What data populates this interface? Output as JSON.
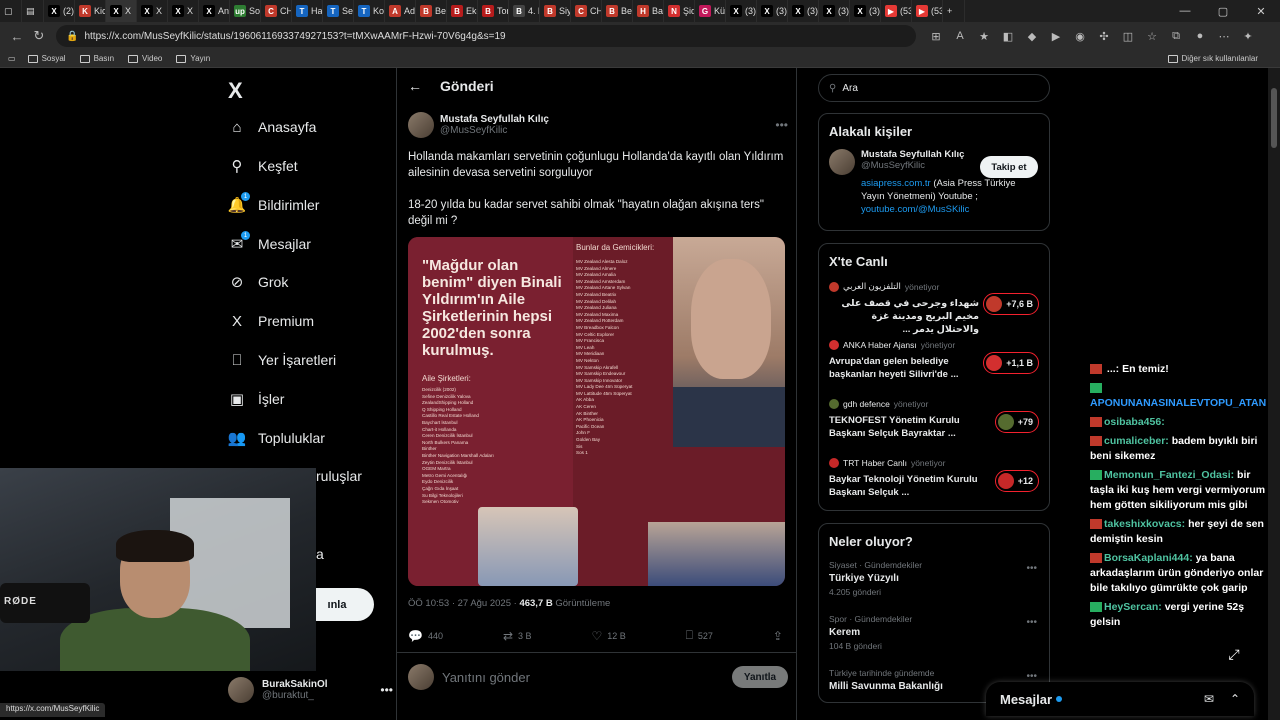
{
  "browser": {
    "tabs": [
      {
        "label": "(2) I",
        "color": "#000000",
        "glyph": "X"
      },
      {
        "label": "Kick",
        "color": "#c0392b",
        "glyph": "K"
      },
      {
        "label": "X",
        "color": "#000000",
        "glyph": "X",
        "active": true
      },
      {
        "label": "X",
        "color": "#000000",
        "glyph": "X"
      },
      {
        "label": "X",
        "color": "#000000",
        "glyph": "X"
      },
      {
        "label": "Ana",
        "color": "#000000",
        "glyph": "X"
      },
      {
        "label": "Son",
        "color": "#2e7d32",
        "glyph": "up"
      },
      {
        "label": "CHF",
        "color": "#c0392b",
        "glyph": "C"
      },
      {
        "label": "Hali",
        "color": "#1565c0",
        "glyph": "T"
      },
      {
        "label": "Selv",
        "color": "#1565c0",
        "glyph": "T"
      },
      {
        "label": "Kon",
        "color": "#1565c0",
        "glyph": "T"
      },
      {
        "label": "Ada",
        "color": "#c0392b",
        "glyph": "A"
      },
      {
        "label": "Bey",
        "color": "#c0392b",
        "glyph": "B"
      },
      {
        "label": "Eko",
        "color": "#b71c1c",
        "glyph": "B"
      },
      {
        "label": "Ton",
        "color": "#b71c1c",
        "glyph": "B"
      },
      {
        "label": "4. li",
        "color": "#444444",
        "glyph": "B"
      },
      {
        "label": "Siya",
        "color": "#c0392b",
        "glyph": "B"
      },
      {
        "label": "CHF",
        "color": "#c0392b",
        "glyph": "C"
      },
      {
        "label": "Bey",
        "color": "#c0392b",
        "glyph": "B"
      },
      {
        "label": "Bak",
        "color": "#c0392b",
        "glyph": "H"
      },
      {
        "label": "Şidd",
        "color": "#d32f2f",
        "glyph": "N"
      },
      {
        "label": "Kür",
        "color": "#c2185b",
        "glyph": "G"
      },
      {
        "label": "(3) ",
        "color": "#000000",
        "glyph": "X"
      },
      {
        "label": "(3) ",
        "color": "#000000",
        "glyph": "X"
      },
      {
        "label": "(3) ",
        "color": "#000000",
        "glyph": "X"
      },
      {
        "label": "(3) ",
        "color": "#000000",
        "glyph": "X"
      },
      {
        "label": "(3) ",
        "color": "#000000",
        "glyph": "X"
      },
      {
        "label": "(53",
        "color": "#e53935",
        "glyph": "▶"
      },
      {
        "label": "(53",
        "color": "#e53935",
        "glyph": "▶"
      }
    ],
    "url": "https://x.com/MusSeyfKilic/status/1960611693374927153?t=tMXwAAMrF-Hzwi-70V6g4g&s=19",
    "bookmarks": [
      "Sosyal",
      "Basın",
      "Video",
      "Yayın"
    ],
    "bookmarks_other": "Diğer sık kullanılanlar",
    "status_url": "https://x.com/MusSeyfKilic"
  },
  "nav": {
    "items": [
      {
        "label": "Anasayfa",
        "icon": "home-icon",
        "glyph": "⌂"
      },
      {
        "label": "Keşfet",
        "icon": "search-icon",
        "glyph": "⚲"
      },
      {
        "label": "Bildirimler",
        "icon": "bell-icon",
        "glyph": "🔔",
        "badge": "1"
      },
      {
        "label": "Mesajlar",
        "icon": "mail-icon",
        "glyph": "✉",
        "badge": "1"
      },
      {
        "label": "Grok",
        "icon": "grok-icon",
        "glyph": "⊘"
      },
      {
        "label": "Premium",
        "icon": "x-premium-icon",
        "glyph": "X"
      },
      {
        "label": "Yer İşaretleri",
        "icon": "bookmark-icon",
        "glyph": "⎕"
      },
      {
        "label": "İşler",
        "icon": "briefcase-icon",
        "glyph": "▣"
      },
      {
        "label": "Topluluklar",
        "icon": "communities-icon",
        "glyph": "👥"
      },
      {
        "label": "ruluşlar",
        "icon": "",
        "glyph": ""
      },
      {
        "label": "a",
        "icon": "",
        "glyph": ""
      }
    ],
    "post_button": "ınla",
    "profile": {
      "name": "BurakSakinOl",
      "handle": "@buraktut_"
    }
  },
  "webcam": {
    "brand": "RØDE"
  },
  "post": {
    "header_title": "Gönderi",
    "author_name": "Mustafa Seyfullah Kılıç",
    "author_handle": "@MusSeyfKilic",
    "text1": "Hollanda makamları servetinin çoğunlugu Hollanda'da kayıtlı olan Yıldırım ailesinin devasa servetini sorguluyor",
    "text2": "18-20 yılda bu kadar servet sahibi olmak \"hayatın olağan akışına ters\" değil mi ?",
    "image": {
      "quote": "\"Mağdur olan benim\" diyen Binali Yıldırım'ın Aile Şirketlerinin hepsi 2002'den sonra kurulmuş.",
      "aile_title": "Aile Şirketleri:",
      "aile_list": [
        "Denizcilik (2002)",
        "Sefine Denizcilik Yalova",
        "ZealandShipping Holland",
        "Q Shipping Holland",
        "Castillo Real Estate Holland",
        "Baychart İstanbul",
        "Chart-it Hollanda",
        "Ceren Denizcilik İstanbul",
        "North Bulkers Panama",
        "Binther",
        "Binther Navigation Marshall Adaları",
        "Zeytin Denizcilik İstanbul",
        "OGEM Martra",
        "Metro Gemi Acentalığı",
        "Eydo Denizcilik",
        "Çağrı Gıda İnşaat",
        "Su Bilgi Teknolojileri",
        "Sekmen Otomotiv"
      ],
      "gem_title": "Bunlar da Gemicikleri:",
      "gem_list": [
        "MV Zealand Alesta Daloz",
        "MV Zealand Almere",
        "MV Zealand Amalia",
        "MV Zealand Amsterdam",
        "MV Zealand Artane Sylvan",
        "MV Zealand Beatrix",
        "MV Zealand Delilah",
        "MV Zealand Juliana",
        "MV Zealand Maxima",
        "MV Zealand Rotterdam",
        "MV Breadbox Falcon",
        "MV Celtic Explorer",
        "MV Francisca",
        "MV Leah",
        "MV Meridiaan",
        "MV Nekton",
        "MV Samskip Akrafell",
        "MV Samskip Endeavour",
        "MV Samskip Innovator",
        "MV Lady Dee 4Im Süperyat",
        "MV Lattitude 45m Süperyat",
        "AK Abba",
        "AK Ceren",
        "AK Binther",
        "AK Phoenicia",
        "Pacific Ocean",
        "John F",
        "Golden Bay",
        "Sis",
        "Sos 1"
      ]
    },
    "time": "ÖÖ 10:53 · 27 Ağu 2025 · ",
    "views": "463,7 B",
    "views_label": " Görüntüleme",
    "replies": "440",
    "reposts": "3 B",
    "likes": "12 B",
    "bookmarks": "527",
    "reply_placeholder": "Yanıtını gönder",
    "reply_button": "Yanıtla"
  },
  "sidebar": {
    "search_placeholder": "Ara",
    "related_title": "Alakalı kişiler",
    "related": {
      "name": "Mustafa Seyfullah Kılıç",
      "handle": "@MusSeyfKilic",
      "follow": "Takip et",
      "bio_link1": "asiapress.com.tr",
      "bio_text": " (Asia Press Türkiye Yayın Yönetmeni) Youtube ;",
      "bio_link2": "youtube.com/@MusSKilic"
    },
    "live_title": "X'te Canlı",
    "live": [
      {
        "source": "التلفزيون العربي",
        "status": "yönetiyor",
        "text": "شهداء وجرحى في قصف على مخيم البريج ومدينة غزة والاحتلال يدمر ...",
        "count": "+7,6 B",
        "color": "#c0392b"
      },
      {
        "source": "ANKA Haber Ajansı",
        "status": "yönetiyor",
        "text": "Avrupa'dan gelen belediye başkanları heyeti Silivri'de ...",
        "count": "+1,1 B",
        "color": "#d32f2f"
      },
      {
        "source": "gdh defence",
        "status": "yönetiyor",
        "text": "TEKNOFEST Yönetim Kurulu Başkanı Selçuk Bayraktar ...",
        "count": "+79",
        "color": "#556b2f"
      },
      {
        "source": "TRT Haber Canlı",
        "status": "yönetiyor",
        "text": "Baykar Teknoloji Yönetim Kurulu Başkanı Selçuk ...",
        "count": "+12",
        "color": "#c62828"
      }
    ],
    "trends_title": "Neler oluyor?",
    "trends": [
      {
        "category": "Siyaset · Gündemdekiler",
        "name": "Türkiye Yüzyılı",
        "count": "4.205 gönderi"
      },
      {
        "category": "Spor · Gündemdekiler",
        "name": "Kerem",
        "count": "104 B gönderi"
      },
      {
        "category": "Türkiye tarihinde gündemde",
        "name": "Milli Savunma Bakanlığı",
        "count": ""
      }
    ],
    "messages_bar": "Mesajlar"
  },
  "chat": {
    "messages": [
      {
        "user": "",
        "text": "...: En temiz!",
        "cls": "u"
      },
      {
        "user": "APONUNANASINALEVTOPU_ATAN",
        "text": "",
        "cls": "u2"
      },
      {
        "user": "osibaba456:",
        "text": "",
        "cls": "u"
      },
      {
        "user": "cumaliceber:",
        "text": "badem bıyıklı biri beni sikemez",
        "cls": "u"
      },
      {
        "user": "Memonun_Fantezi_Odasi:",
        "text": "bir taşla iki kuş hem vergi vermiyorum hem götten sikiliyorum mis gibi",
        "cls": "u"
      },
      {
        "user": "takeshixkovacs:",
        "text": "her şeyi de sen demiştin kesin",
        "cls": "u"
      },
      {
        "user": "BorsaKaplani444:",
        "text": "ya bana arkadaşlarım ürün gönderiyo onlar bile takılıyo gümrükte çok garip",
        "cls": "u"
      },
      {
        "user": "HeySercan:",
        "text": "vergi yerine 52ş gelsin",
        "cls": "u"
      }
    ]
  }
}
